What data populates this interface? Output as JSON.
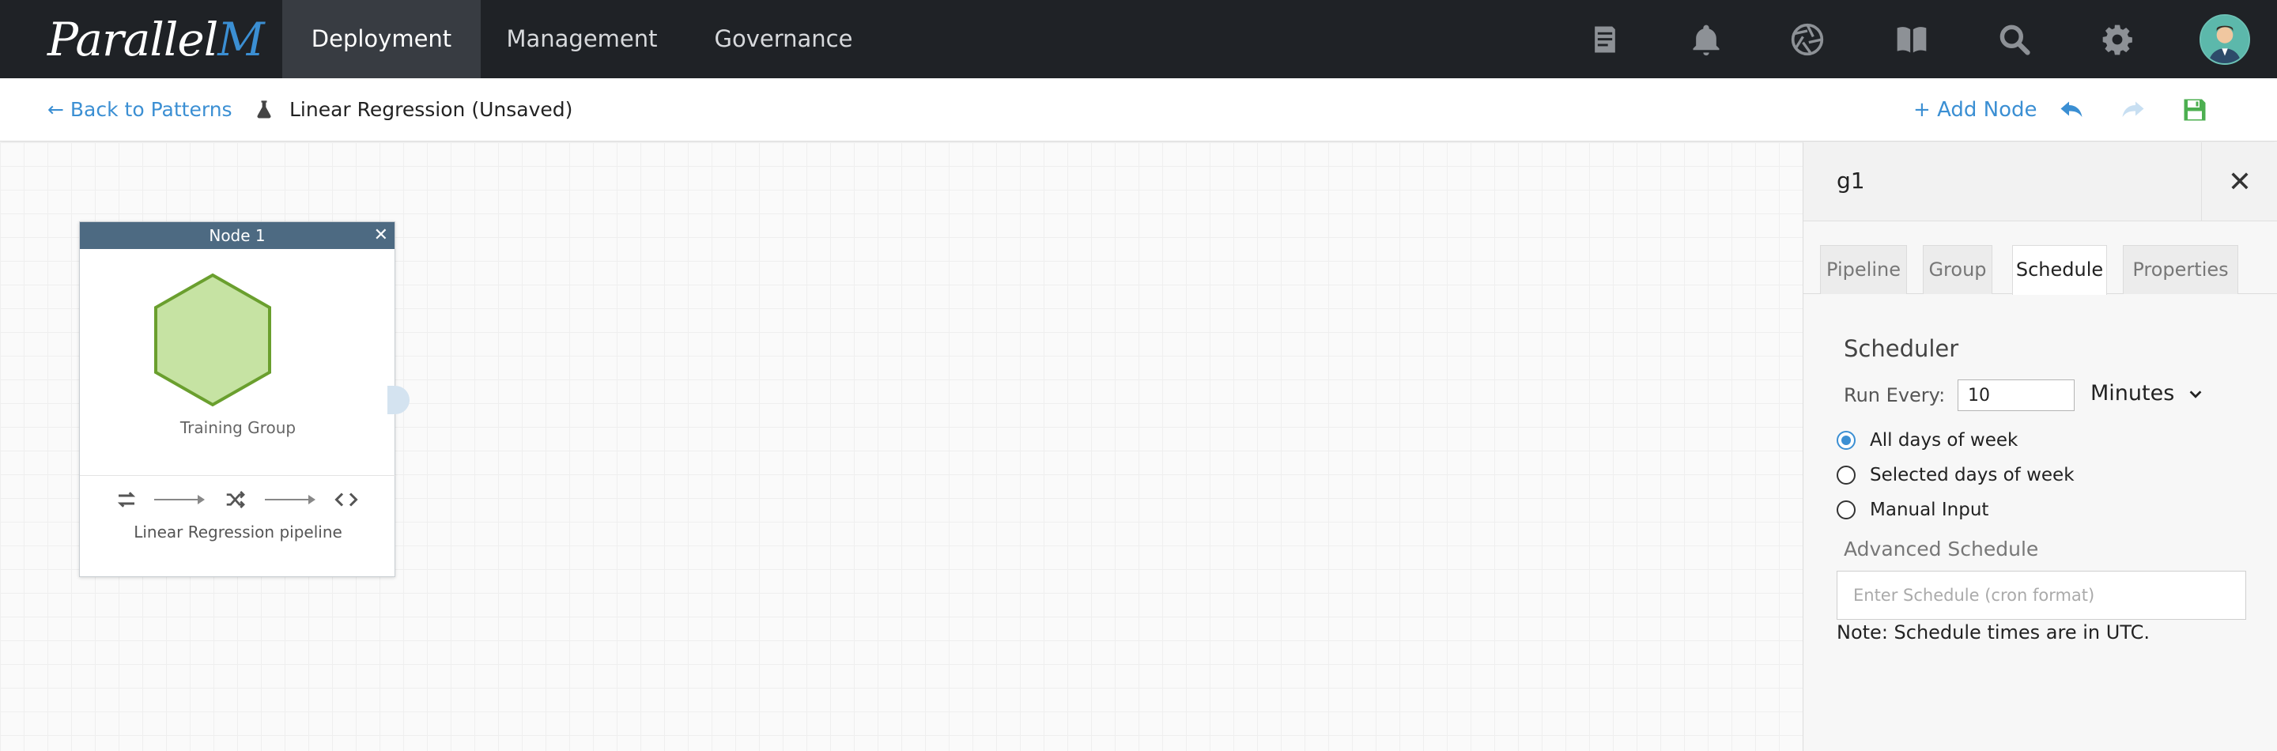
{
  "topnav": {
    "logo": {
      "main": "Parallel",
      "accent": "M"
    },
    "tabs": [
      {
        "label": "Deployment",
        "active": true
      },
      {
        "label": "Management",
        "active": false
      },
      {
        "label": "Governance",
        "active": false
      }
    ],
    "icons": [
      "notes-icon",
      "bell-icon",
      "aperture-icon",
      "book-icon",
      "search-icon",
      "gear-icon"
    ]
  },
  "subnav": {
    "back_label": "Back to Patterns",
    "title": "Linear Regression (Unsaved)",
    "add_node_label": "Add Node"
  },
  "canvas": {
    "node": {
      "header": "Node 1",
      "close": "✕",
      "group_label": "Training Group",
      "pipeline_label": "Linear Regression pipeline",
      "hex_fill": "#c6e3a3",
      "hex_stroke": "#6a9f2e"
    }
  },
  "panel": {
    "title": "g1",
    "close": "✕",
    "tabs": [
      {
        "label": "Pipeline",
        "active": false
      },
      {
        "label": "Group",
        "active": false
      },
      {
        "label": "Schedule",
        "active": true
      },
      {
        "label": "Properties",
        "active": false
      }
    ],
    "scheduler": {
      "title": "Scheduler",
      "run_every_label": "Run Every:",
      "run_every_value": "10",
      "unit": "Minutes",
      "options": [
        {
          "label": "All days of week",
          "checked": true
        },
        {
          "label": "Selected days of week",
          "checked": false
        },
        {
          "label": "Manual Input",
          "checked": false
        }
      ],
      "advanced_label": "Advanced Schedule",
      "cron_placeholder": "Enter Schedule (cron format)",
      "note": "Note: Schedule times are in UTC."
    }
  },
  "colors": {
    "accent": "#3b8fd3",
    "topbar": "#1f2226",
    "save_green": "#4caf50"
  }
}
